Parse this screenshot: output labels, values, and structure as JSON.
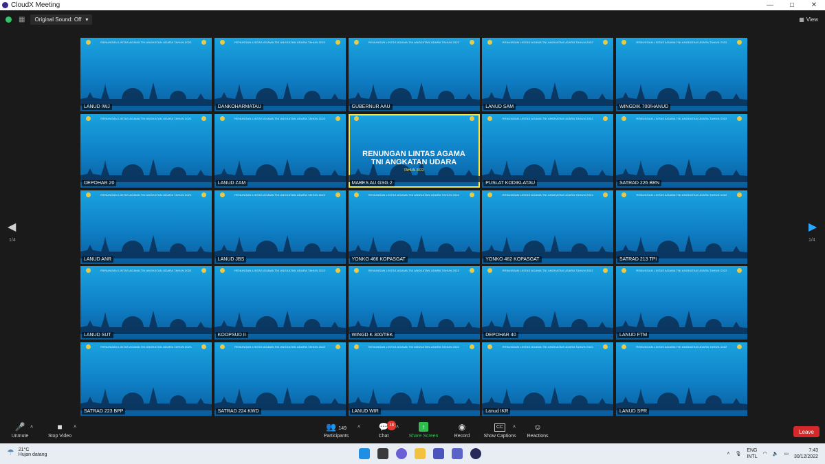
{
  "window": {
    "title": "CloudX Meeting",
    "controls": [
      "—",
      "□",
      "✕"
    ]
  },
  "topbar": {
    "sound_label": "Original Sound: Off",
    "view_label": "View"
  },
  "banner_text": "RENUNGAN LINTAS AGAMA TNI ANGKATAN UDARA TAHUN 2022",
  "feature": {
    "line1": "RENUNGAN LINTAS AGAMA",
    "line2": "TNI ANGKATAN UDARA",
    "line3": "TAHUN 2022"
  },
  "tiles": [
    "LANUD IWJ",
    "DANKOHARMATAU",
    "GUBERNUR AAU",
    "LANUD SAM",
    "WINGDIK 700/HANUD",
    "DEPOHAR 20",
    "LANUD ZAM",
    "MABES AU GSG 2",
    "PUSLAT KODIKLATAU",
    "SATRAD 226 BRN",
    "LANUD ANR",
    "LANUD JBS",
    "YONKO 466 KOPASGAT",
    "YONKO 462 KOPASGAT",
    "SATRAD 213 TPI",
    "LANUD SUT",
    "KOOPSUD II",
    "WINGD K 300/TEK",
    "DEPOHAR 40",
    "LANUD FTM",
    "SATRAD 223 BPP",
    "SATRAD 224 KWD",
    "LANUD WIR",
    "Lanud IKR",
    "LANUD SPR"
  ],
  "pagination": {
    "left": "1/4",
    "right": "1/4"
  },
  "toolbar": {
    "unmute": "Unmute",
    "stop_video": "Stop Video",
    "participants": "Participants",
    "participants_count": "149",
    "chat": "Chat",
    "chat_badge": "18",
    "share": "Share Screen",
    "record": "Record",
    "captions": "Show Captions",
    "captions_icon": "CC",
    "reactions": "Reactions",
    "leave": "Leave"
  },
  "taskbar": {
    "temp": "21°C",
    "weather": "Hujan datang",
    "lang1": "ENG",
    "lang2": "INTL",
    "time": "7:43",
    "date": "30/12/2022"
  },
  "colors": {
    "speaker_outline": "#f5e94a",
    "share_green": "#2fbf4f",
    "leave_red": "#d4282b"
  }
}
